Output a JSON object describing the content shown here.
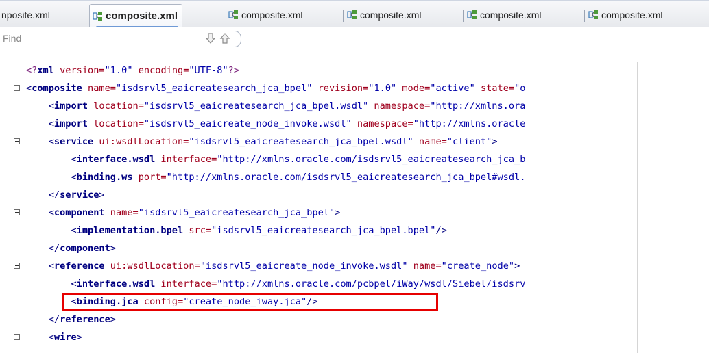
{
  "tabs": [
    {
      "label": "nposite.xml",
      "active": false
    },
    {
      "label": "composite.xml",
      "active": true
    },
    {
      "label": "composite.xml",
      "active": false
    },
    {
      "label": "composite.xml",
      "active": false
    },
    {
      "label": "composite.xml",
      "active": false
    },
    {
      "label": "composite.xml",
      "active": false
    }
  ],
  "find": {
    "placeholder": "Find",
    "next_icon": "arrow-down-icon",
    "prev_icon": "arrow-up-icon"
  },
  "editor": {
    "lines": [
      {
        "fold": false,
        "segments": [
          [
            "pi",
            "<?"
          ],
          [
            "tag",
            "xml"
          ],
          [
            "attr",
            " version="
          ],
          [
            "val",
            "\"1.0\""
          ],
          [
            "attr",
            " encoding="
          ],
          [
            "val",
            "\"UTF-8\""
          ],
          [
            "pi",
            "?>"
          ]
        ]
      },
      {
        "fold": true,
        "segments": [
          [
            "punct",
            "<"
          ],
          [
            "tag",
            "composite"
          ],
          [
            "attr",
            " name="
          ],
          [
            "val",
            "\"isdsrvl5_eaicreatesearch_jca_bpel\""
          ],
          [
            "attr",
            " revision="
          ],
          [
            "val",
            "\"1.0\""
          ],
          [
            "attr",
            " mode="
          ],
          [
            "val",
            "\"active\""
          ],
          [
            "attr",
            " state="
          ],
          [
            "val",
            "\"o"
          ]
        ]
      },
      {
        "fold": false,
        "segments": [
          [
            "punct",
            "    <"
          ],
          [
            "tag",
            "import"
          ],
          [
            "attr",
            " location="
          ],
          [
            "val",
            "\"isdsrvl5_eaicreatesearch_jca_bpel.wsdl\""
          ],
          [
            "attr",
            " namespace="
          ],
          [
            "val",
            "\"http://xmlns.ora"
          ]
        ]
      },
      {
        "fold": false,
        "segments": [
          [
            "punct",
            "    <"
          ],
          [
            "tag",
            "import"
          ],
          [
            "attr",
            " location="
          ],
          [
            "val",
            "\"isdsrvl5_eaicreate_node_invoke.wsdl\""
          ],
          [
            "attr",
            " namespace="
          ],
          [
            "val",
            "\"http://xmlns.oracle"
          ]
        ]
      },
      {
        "fold": true,
        "segments": [
          [
            "punct",
            "    <"
          ],
          [
            "tag",
            "service"
          ],
          [
            "attr",
            " ui:wsdlLocation="
          ],
          [
            "val",
            "\"isdsrvl5_eaicreatesearch_jca_bpel.wsdl\""
          ],
          [
            "attr",
            " name="
          ],
          [
            "val",
            "\"client\""
          ],
          [
            "punct",
            ">"
          ]
        ]
      },
      {
        "fold": false,
        "segments": [
          [
            "punct",
            "        <"
          ],
          [
            "tag",
            "interface.wsdl"
          ],
          [
            "attr",
            " interface="
          ],
          [
            "val",
            "\"http://xmlns.oracle.com/isdsrvl5_eaicreatesearch_jca_b"
          ]
        ]
      },
      {
        "fold": false,
        "segments": [
          [
            "punct",
            "        <"
          ],
          [
            "tag",
            "binding.ws"
          ],
          [
            "attr",
            " port="
          ],
          [
            "val",
            "\"http://xmlns.oracle.com/isdsrvl5_eaicreatesearch_jca_bpel#wsdl."
          ]
        ]
      },
      {
        "fold": false,
        "segments": [
          [
            "punct",
            "    </"
          ],
          [
            "tag",
            "service"
          ],
          [
            "punct",
            ">"
          ]
        ]
      },
      {
        "fold": true,
        "segments": [
          [
            "punct",
            "    <"
          ],
          [
            "tag",
            "component"
          ],
          [
            "attr",
            " name="
          ],
          [
            "val",
            "\"isdsrvl5_eaicreatesearch_jca_bpel\""
          ],
          [
            "punct",
            ">"
          ]
        ]
      },
      {
        "fold": false,
        "segments": [
          [
            "punct",
            "        <"
          ],
          [
            "tag",
            "implementation.bpel"
          ],
          [
            "attr",
            " src="
          ],
          [
            "val",
            "\"isdsrvl5_eaicreatesearch_jca_bpel.bpel\""
          ],
          [
            "punct",
            "/>"
          ]
        ]
      },
      {
        "fold": false,
        "segments": [
          [
            "punct",
            "    </"
          ],
          [
            "tag",
            "component"
          ],
          [
            "punct",
            ">"
          ]
        ]
      },
      {
        "fold": true,
        "segments": [
          [
            "punct",
            "    <"
          ],
          [
            "tag",
            "reference"
          ],
          [
            "attr",
            " ui:wsdlLocation="
          ],
          [
            "val",
            "\"isdsrvl5_eaicreate_node_invoke.wsdl\""
          ],
          [
            "attr",
            " name="
          ],
          [
            "val",
            "\"create_node\""
          ],
          [
            "punct",
            ">"
          ]
        ]
      },
      {
        "fold": false,
        "segments": [
          [
            "punct",
            "        <"
          ],
          [
            "tag",
            "interface.wsdl"
          ],
          [
            "attr",
            " interface="
          ],
          [
            "val",
            "\"http://xmlns.oracle.com/pcbpel/iWay/wsdl/Siebel/isdsrv"
          ]
        ]
      },
      {
        "fold": false,
        "segments": [
          [
            "punct",
            "        <"
          ],
          [
            "tag",
            "binding.jca"
          ],
          [
            "attr",
            " config="
          ],
          [
            "val",
            "\"create_node_iway.jca\""
          ],
          [
            "punct",
            "/>"
          ]
        ]
      },
      {
        "fold": false,
        "segments": [
          [
            "punct",
            "    </"
          ],
          [
            "tag",
            "reference"
          ],
          [
            "punct",
            ">"
          ]
        ]
      },
      {
        "fold": true,
        "segments": [
          [
            "punct",
            "    <"
          ],
          [
            "tag",
            "wire"
          ],
          [
            "punct",
            ">"
          ]
        ]
      }
    ],
    "highlighted_line": 13,
    "highlight_color": "#e60000"
  }
}
